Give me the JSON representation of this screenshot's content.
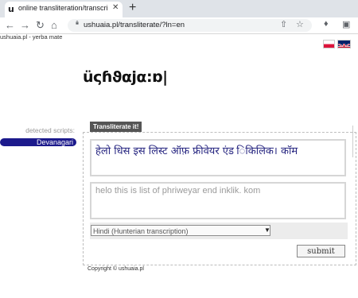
{
  "browser": {
    "tab_title": "online transliteration/transcription",
    "tab_close": "✕",
    "new_tab": "+",
    "url": "ushuaia.pl/transliterate/?ln=en",
    "favicon": "u"
  },
  "page": {
    "breadcrumb": "ushuaia.pl - yerba mate",
    "logo_text": "üςɦϑαjα:ɒ|",
    "detected_label": "detected scripts:",
    "detected_script": "Devanagari",
    "tab_label": "Transliterate it!",
    "output_text": "हेलो धिस इस लिस्ट ऑफ़ फ्रीवेयर एंड िकिलिक। कॉम",
    "input_text": "helo this is list of phriweyar end inklik. kom",
    "select_value": "Hindi (Hunterian transcription)",
    "submit_label": "submit",
    "copyright": "Copyright © ushuaia.pl"
  },
  "colors": {
    "script_pill": "#1c1a8c",
    "output_text": "#262580",
    "tab_label_bg": "#555555"
  },
  "icons": [
    "back-icon",
    "forward-icon",
    "reload-icon",
    "home-icon",
    "lock-icon",
    "share-icon",
    "star-icon",
    "extensions-icon",
    "sidebar-icon"
  ]
}
